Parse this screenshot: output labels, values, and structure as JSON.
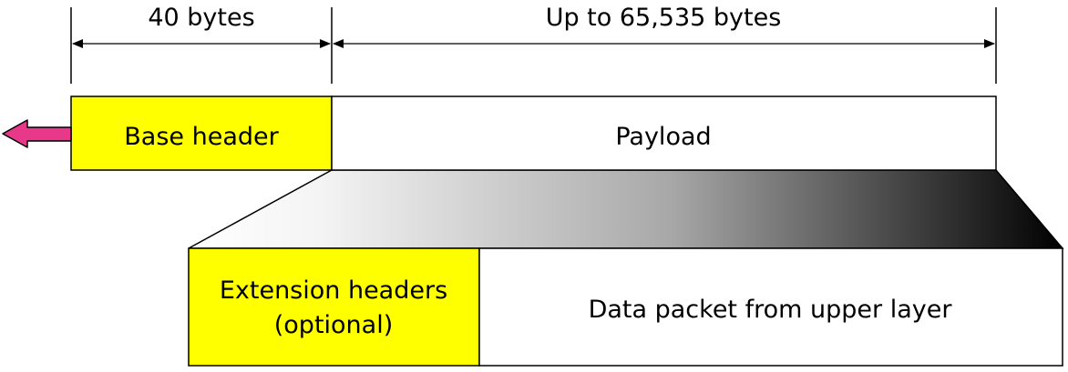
{
  "dimensions": {
    "header_size_label": "40 bytes",
    "payload_size_label": "Up to 65,535 bytes"
  },
  "packet": {
    "base_header_label": "Base header",
    "payload_label": "Payload"
  },
  "payload_detail": {
    "extension_headers_line1": "Extension headers",
    "extension_headers_line2": "(optional)",
    "data_packet_label": "Data packet from upper layer"
  },
  "colors": {
    "header_fill": "#ffff00",
    "arrow_fill": "#e8388a",
    "outline": "#000000",
    "background": "#ffffff"
  }
}
